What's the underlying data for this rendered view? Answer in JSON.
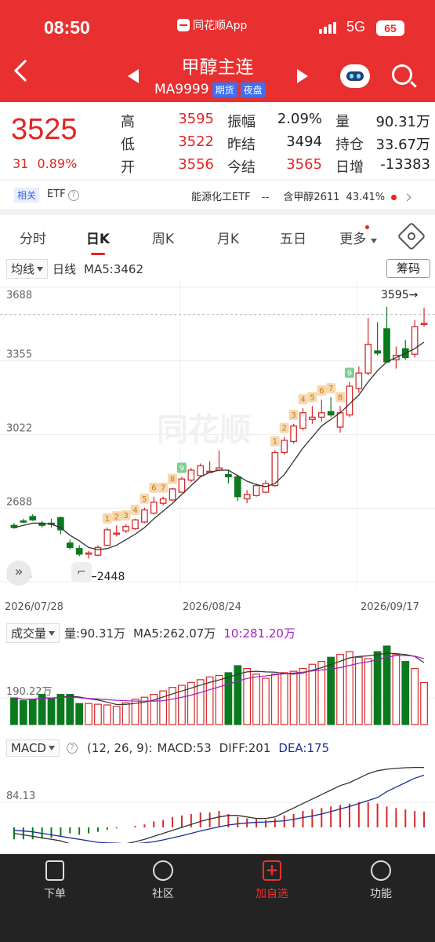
{
  "status_bar": {
    "time": "08:50",
    "app_name": "同花顺App",
    "network": "5G",
    "battery": "65"
  },
  "header": {
    "title": "甲醇主连",
    "code": "MA9999",
    "tags": [
      "期货",
      "夜盘"
    ],
    "icons": [
      "back-icon",
      "prev-icon",
      "next-icon",
      "robot-icon",
      "search-icon"
    ]
  },
  "quote": {
    "price": "3525",
    "change": "31",
    "change_pct": "0.89%",
    "rows": [
      {
        "l1": "高",
        "v1": "3595",
        "l2": "振幅",
        "v2": "2.09%",
        "l3": "量",
        "v3": "90.31万"
      },
      {
        "l1": "低",
        "v1": "3522",
        "l2": "昨结",
        "v2": "3494",
        "l3": "持仓",
        "v3": "33.67万"
      },
      {
        "l1": "开",
        "v1": "3556",
        "l2": "今结",
        "v2": "3565",
        "l3": "日增",
        "v3": "-13383"
      }
    ]
  },
  "related": {
    "tag": "相关",
    "etf": "ETF",
    "help": "?",
    "right_name": "能源化工ETF",
    "right_value": "--",
    "right_holding": "含甲醇2611",
    "right_pct": "43.41%"
  },
  "tabs": [
    "分时",
    "日K",
    "周K",
    "月K",
    "五日",
    "更多"
  ],
  "active_tab": "日K",
  "kline": {
    "indicator_button": "均线",
    "period": "日线",
    "ma5_label": "MA5:3462",
    "chouma_button": "筹码",
    "y_labels": [
      "3688",
      "3355",
      "3022",
      "2688",
      "2355"
    ],
    "high_marker": "3595→",
    "low_marker": "←2448",
    "dates": [
      "2026/07/28",
      "2026/08/24",
      "2026/09/17"
    ],
    "watermark": "同花顺"
  },
  "chart_data": [
    {
      "type": "candlestick",
      "title": "日K",
      "ylim": [
        2355,
        3688
      ],
      "ma5_last": 3462,
      "high": 3595,
      "low": 2448,
      "candles": [
        {
          "o": 2610,
          "h": 2620,
          "l": 2595,
          "c": 2600
        },
        {
          "o": 2630,
          "h": 2640,
          "l": 2620,
          "c": 2625
        },
        {
          "o": 2650,
          "h": 2660,
          "l": 2630,
          "c": 2635
        },
        {
          "o": 2620,
          "h": 2630,
          "l": 2600,
          "c": 2610
        },
        {
          "o": 2620,
          "h": 2640,
          "l": 2600,
          "c": 2615
        },
        {
          "o": 2645,
          "h": 2650,
          "l": 2570,
          "c": 2590
        },
        {
          "o": 2530,
          "h": 2545,
          "l": 2500,
          "c": 2510
        },
        {
          "o": 2505,
          "h": 2520,
          "l": 2470,
          "c": 2480
        },
        {
          "o": 2480,
          "h": 2495,
          "l": 2460,
          "c": 2485
        },
        {
          "o": 2475,
          "h": 2520,
          "l": 2470,
          "c": 2510
        },
        {
          "o": 2520,
          "h": 2600,
          "l": 2515,
          "c": 2590
        },
        {
          "o": 2570,
          "h": 2610,
          "l": 2560,
          "c": 2575
        },
        {
          "o": 2585,
          "h": 2615,
          "l": 2575,
          "c": 2605
        },
        {
          "o": 2595,
          "h": 2640,
          "l": 2590,
          "c": 2635
        },
        {
          "o": 2625,
          "h": 2690,
          "l": 2620,
          "c": 2680
        },
        {
          "o": 2665,
          "h": 2740,
          "l": 2660,
          "c": 2715
        },
        {
          "o": 2710,
          "h": 2740,
          "l": 2700,
          "c": 2730
        },
        {
          "o": 2725,
          "h": 2780,
          "l": 2720,
          "c": 2775
        },
        {
          "o": 2760,
          "h": 2830,
          "l": 2760,
          "c": 2820
        },
        {
          "o": 2815,
          "h": 2870,
          "l": 2805,
          "c": 2860
        },
        {
          "o": 2835,
          "h": 2890,
          "l": 2830,
          "c": 2880
        },
        {
          "o": 2855,
          "h": 2900,
          "l": 2850,
          "c": 2855
        },
        {
          "o": 2860,
          "h": 2950,
          "l": 2855,
          "c": 2870
        },
        {
          "o": 2840,
          "h": 2860,
          "l": 2800,
          "c": 2830
        },
        {
          "o": 2830,
          "h": 2840,
          "l": 2720,
          "c": 2740
        },
        {
          "o": 2730,
          "h": 2770,
          "l": 2710,
          "c": 2750
        },
        {
          "o": 2745,
          "h": 2800,
          "l": 2740,
          "c": 2790
        },
        {
          "o": 2760,
          "h": 2815,
          "l": 2755,
          "c": 2800
        },
        {
          "o": 2790,
          "h": 2950,
          "l": 2785,
          "c": 2940
        },
        {
          "o": 2940,
          "h": 3010,
          "l": 2930,
          "c": 2995
        },
        {
          "o": 2990,
          "h": 3070,
          "l": 2980,
          "c": 3060
        },
        {
          "o": 3050,
          "h": 3140,
          "l": 3040,
          "c": 3120
        },
        {
          "o": 3090,
          "h": 3150,
          "l": 3070,
          "c": 3100
        },
        {
          "o": 3100,
          "h": 3180,
          "l": 3080,
          "c": 3120
        },
        {
          "o": 3125,
          "h": 3190,
          "l": 3100,
          "c": 3110
        },
        {
          "o": 3055,
          "h": 3150,
          "l": 3030,
          "c": 3120
        },
        {
          "o": 3110,
          "h": 3260,
          "l": 3100,
          "c": 3240
        },
        {
          "o": 3230,
          "h": 3330,
          "l": 3210,
          "c": 3300
        },
        {
          "o": 3300,
          "h": 3550,
          "l": 3290,
          "c": 3430
        },
        {
          "o": 3400,
          "h": 3530,
          "l": 3380,
          "c": 3390
        },
        {
          "o": 3500,
          "h": 3600,
          "l": 3420,
          "c": 3350
        },
        {
          "o": 3360,
          "h": 3420,
          "l": 3320,
          "c": 3380
        },
        {
          "o": 3410,
          "h": 3450,
          "l": 3360,
          "c": 3370
        },
        {
          "o": 3385,
          "h": 3540,
          "l": 3370,
          "c": 3510
        },
        {
          "o": 3520,
          "h": 3595,
          "l": 3510,
          "c": 3525
        }
      ],
      "ma5": [
        2600,
        2610,
        2620,
        2620,
        2615,
        2600,
        2565,
        2540,
        2510,
        2500,
        2505,
        2520,
        2545,
        2570,
        2600,
        2640,
        2675,
        2710,
        2750,
        2790,
        2830,
        2850,
        2860,
        2860,
        2835,
        2810,
        2795,
        2785,
        2800,
        2840,
        2900,
        2960,
        3010,
        3060,
        3090,
        3120,
        3160,
        3200,
        3260,
        3310,
        3350,
        3370,
        3390,
        3410,
        3440
      ],
      "td_labels": [
        {
          "i": 10,
          "n": "1"
        },
        {
          "i": 11,
          "n": "2"
        },
        {
          "i": 12,
          "n": "3"
        },
        {
          "i": 13,
          "n": "4"
        },
        {
          "i": 14,
          "n": "5"
        },
        {
          "i": 15,
          "n": "6"
        },
        {
          "i": 16,
          "n": "7"
        },
        {
          "i": 17,
          "n": "8"
        },
        {
          "i": 18,
          "n": "9"
        },
        {
          "i": 28,
          "n": "1"
        },
        {
          "i": 29,
          "n": "2"
        },
        {
          "i": 30,
          "n": "3"
        },
        {
          "i": 31,
          "n": "4"
        },
        {
          "i": 32,
          "n": "5"
        },
        {
          "i": 33,
          "n": "6"
        },
        {
          "i": 34,
          "n": "7"
        },
        {
          "i": 35,
          "n": "8"
        },
        {
          "i": 36,
          "n": "9"
        }
      ]
    },
    {
      "type": "bar",
      "title": "成交量",
      "value_label": "量:90.31万",
      "ma5_label": "MA5:262.07万",
      "ma10_label": "10:281.20万",
      "y_label": "190.22万",
      "values": [
        190,
        170,
        180,
        215,
        190,
        215,
        215,
        150,
        150,
        145,
        140,
        130,
        155,
        180,
        195,
        215,
        240,
        265,
        280,
        300,
        320,
        340,
        350,
        370,
        420,
        400,
        360,
        330,
        360,
        370,
        380,
        400,
        430,
        450,
        480,
        500,
        520,
        480,
        470,
        520,
        560,
        500,
        450,
        400,
        300
      ]
    },
    {
      "type": "bar",
      "title": "MACD",
      "params": "(12, 26, 9):",
      "macd_label": "MACD:53",
      "diff_label": "DIFF:201",
      "dea_label": "DEA:175",
      "y_label": "84.13",
      "macd": [
        -40,
        -40,
        -40,
        -38,
        -35,
        -30,
        -20,
        -25,
        -20,
        -15,
        -8,
        -3,
        0,
        5,
        10,
        20,
        25,
        35,
        40,
        45,
        50,
        50,
        55,
        45,
        35,
        30,
        28,
        25,
        30,
        40,
        45,
        55,
        60,
        65,
        70,
        75,
        80,
        85,
        85,
        80,
        70,
        65,
        60,
        55,
        53
      ],
      "diff": [
        -20,
        -25,
        -30,
        -35,
        -40,
        -45,
        -55,
        -60,
        -65,
        -70,
        -65,
        -60,
        -55,
        -48,
        -40,
        -30,
        -20,
        -10,
        0,
        10,
        20,
        28,
        35,
        40,
        40,
        35,
        30,
        30,
        35,
        50,
        65,
        80,
        95,
        110,
        125,
        140,
        150,
        165,
        180,
        190,
        195,
        198,
        200,
        201,
        201
      ],
      "dea": [
        -10,
        -12,
        -15,
        -20,
        -25,
        -30,
        -35,
        -40,
        -45,
        -50,
        -52,
        -53,
        -55,
        -55,
        -52,
        -48,
        -42,
        -35,
        -28,
        -20,
        -12,
        -5,
        2,
        8,
        12,
        15,
        17,
        18,
        20,
        22,
        27,
        33,
        38,
        45,
        53,
        62,
        70,
        80,
        90,
        100,
        120,
        135,
        150,
        165,
        175
      ]
    }
  ],
  "bottom_nav": [
    {
      "label": "下单",
      "icon": "order-icon"
    },
    {
      "label": "社区",
      "icon": "community-icon"
    },
    {
      "label": "加自选",
      "icon": "add-watchlist-icon"
    },
    {
      "label": "功能",
      "icon": "menu-icon"
    }
  ]
}
